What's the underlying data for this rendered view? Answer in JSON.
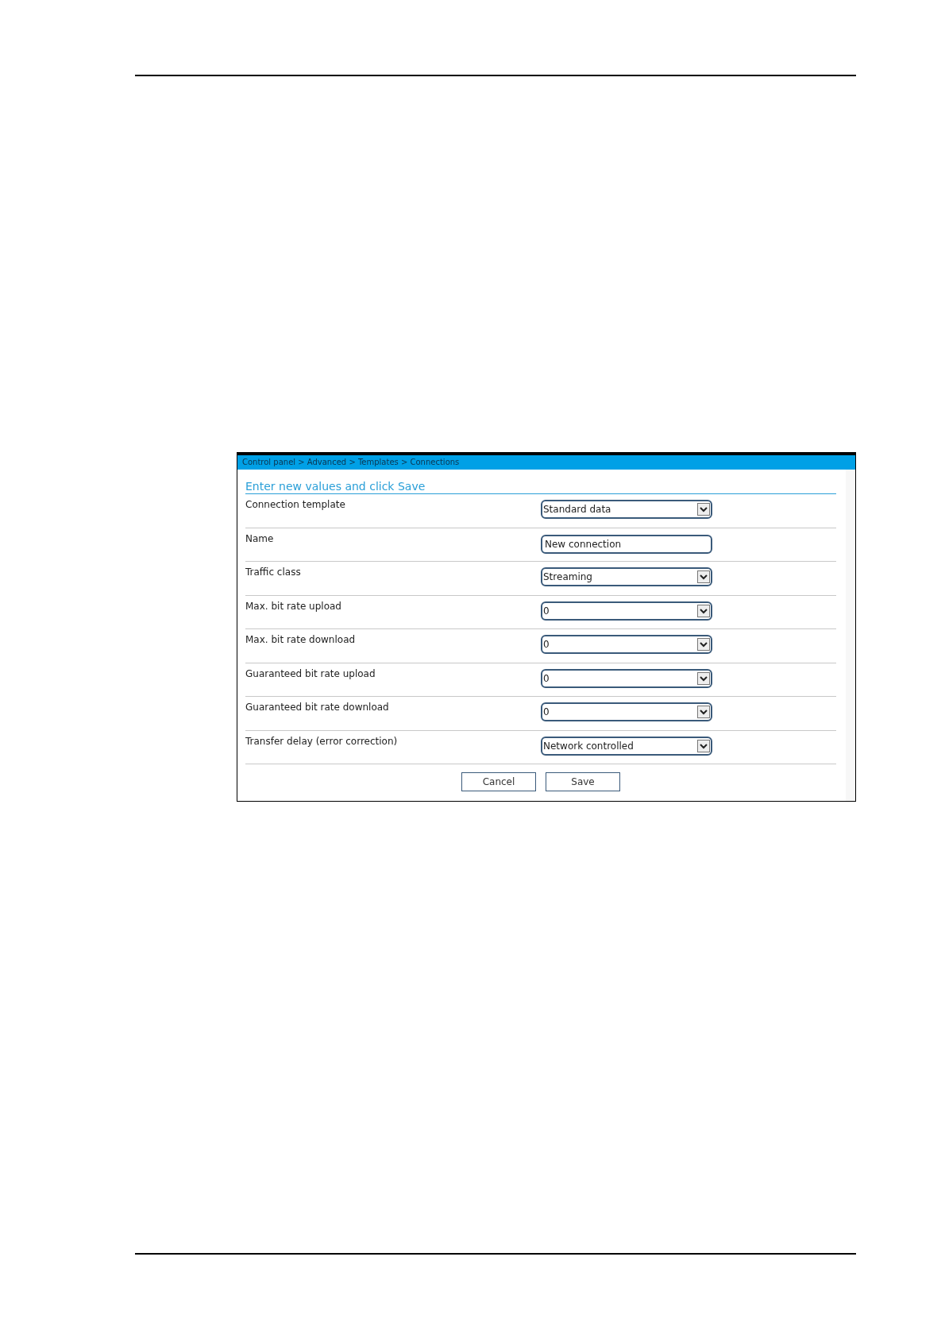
{
  "breadcrumb": "Control panel > Advanced > Templates > Connections",
  "heading": "Enter new values and click Save",
  "fields": [
    {
      "label": "Connection template",
      "kind": "select",
      "value": "Standard data"
    },
    {
      "label": "Name",
      "kind": "text",
      "value": "New connection"
    },
    {
      "label": "Traffic class",
      "kind": "select",
      "value": "Streaming"
    },
    {
      "label": "Max. bit rate upload",
      "kind": "select",
      "value": "0"
    },
    {
      "label": "Max. bit rate download",
      "kind": "select",
      "value": "0"
    },
    {
      "label": "Guaranteed bit rate upload",
      "kind": "select",
      "value": "0"
    },
    {
      "label": "Guaranteed bit rate download",
      "kind": "select",
      "value": "0"
    },
    {
      "label": "Transfer delay (error correction)",
      "kind": "select",
      "value": "Network controlled"
    }
  ],
  "buttons": [
    "Cancel",
    "Save"
  ]
}
